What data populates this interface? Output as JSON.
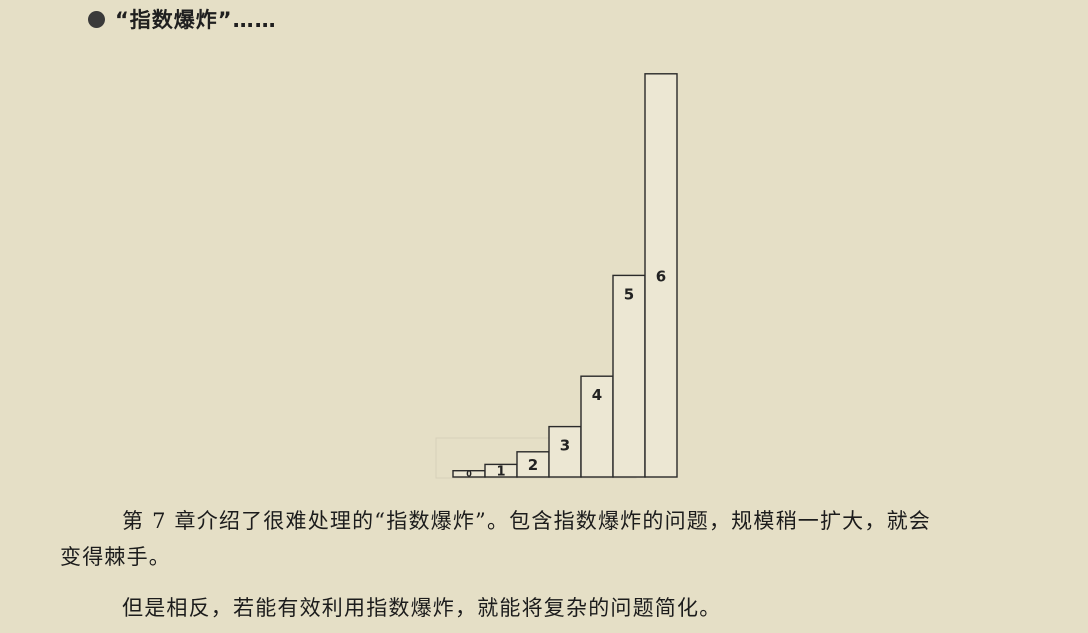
{
  "section": {
    "bullet_icon": "filled-circle-icon",
    "title": "“指数爆炸”……"
  },
  "figure": {
    "steps": [
      {
        "label": "0",
        "value": 1
      },
      {
        "label": "1",
        "value": 2
      },
      {
        "label": "2",
        "value": 4
      },
      {
        "label": "3",
        "value": 8
      },
      {
        "label": "4",
        "value": 16
      },
      {
        "label": "5",
        "value": 32
      },
      {
        "label": "6",
        "value": 64
      }
    ]
  },
  "body": {
    "paragraph1_line1": "第 7 章介绍了很难处理的“指数爆炸”。包含指数爆炸的问题，规模稍一扩大，就会",
    "paragraph1_line2": "变得棘手。",
    "paragraph2": "但是相反，若能有效利用指数爆炸，就能将复杂的问题简化。"
  }
}
